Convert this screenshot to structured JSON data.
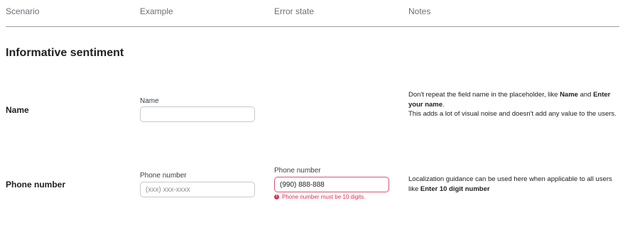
{
  "headers": [
    "Scenario",
    "Example",
    "Error state",
    "Notes"
  ],
  "section_title": "Informative sentiment",
  "rows": [
    {
      "scenario": "Name",
      "example": {
        "label": "Name",
        "value": "",
        "placeholder": ""
      },
      "notes": {
        "p1_a": "Don't repeat the field name in the placeholder, like ",
        "p1_b": "Name",
        "p1_c": " and ",
        "p1_d": "Enter your name",
        "p1_e": ".",
        "p2": "This adds a lot of visual noise and doesn't add any value to the users."
      }
    },
    {
      "scenario": "Phone number",
      "example": {
        "label": "Phone number",
        "value": "",
        "placeholder": "(xxx) xxx-xxxx"
      },
      "error_state": {
        "label": "Phone number",
        "value": "(990) 888-888",
        "message": "Phone number must be 10 digits.",
        "icon": "error-icon",
        "color": "#d6334f"
      },
      "notes": {
        "p1_a": "Localization guidance can be used here when applicable to all users like ",
        "p1_b": "Enter 10 digit number"
      }
    }
  ]
}
